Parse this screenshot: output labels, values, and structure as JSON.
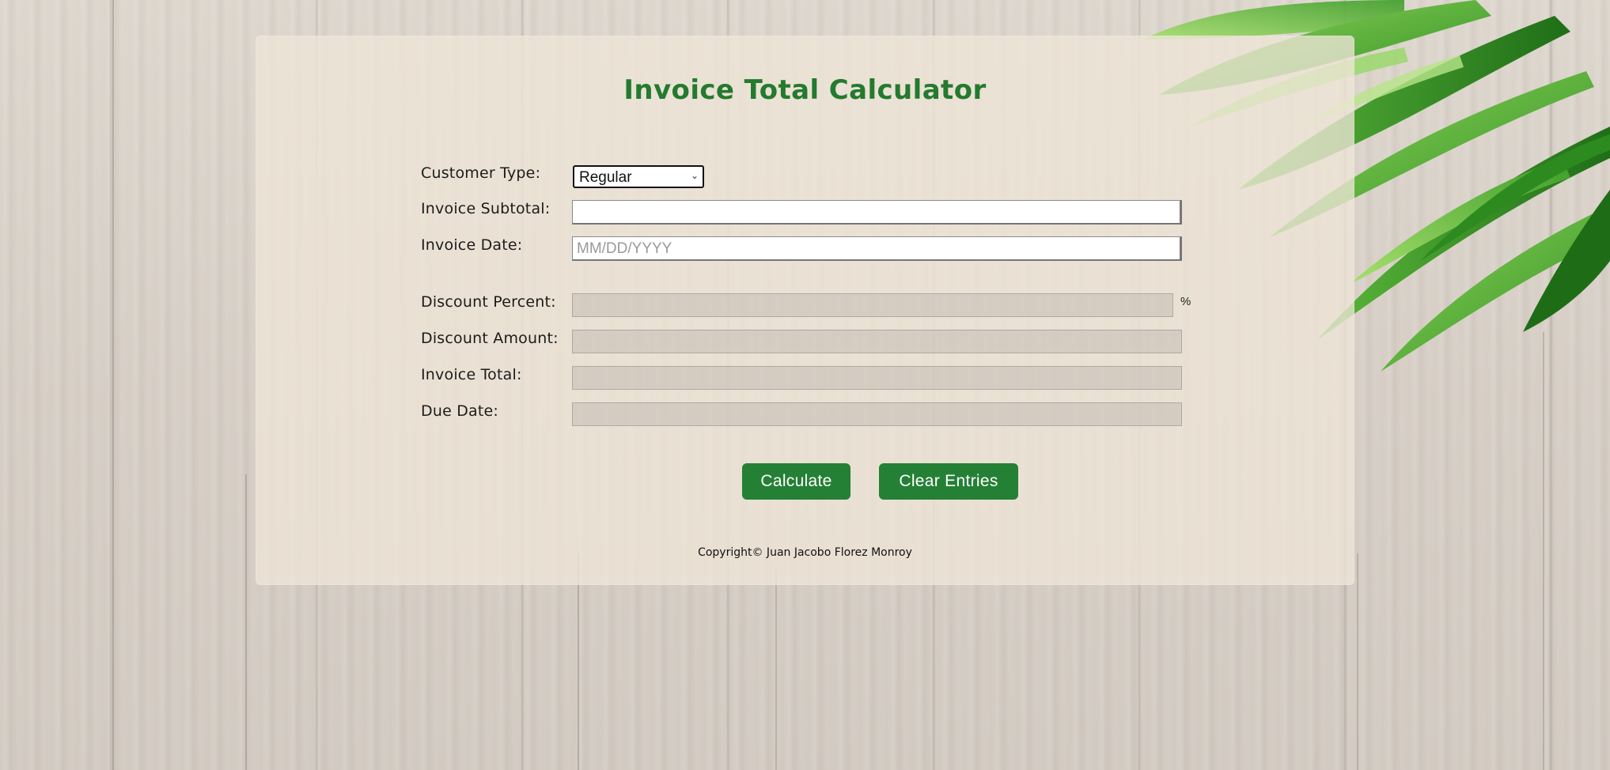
{
  "page": {
    "title": "Invoice Total Calculator",
    "copyright": "Copyright© Juan Jacobo Florez Monroy"
  },
  "form": {
    "customer_type": {
      "label": "Customer Type:",
      "selected": "Regular"
    },
    "invoice_subtotal": {
      "label": "Invoice Subtotal:",
      "value": ""
    },
    "invoice_date": {
      "label": "Invoice Date:",
      "placeholder": "MM/DD/YYYY",
      "value": ""
    },
    "discount_percent": {
      "label": "Discount Percent:",
      "value": "",
      "unit": "%"
    },
    "discount_amount": {
      "label": "Discount Amount:",
      "value": ""
    },
    "invoice_total": {
      "label": "Invoice Total:",
      "value": ""
    },
    "due_date": {
      "label": "Due Date:",
      "value": ""
    }
  },
  "buttons": {
    "calculate": "Calculate",
    "clear": "Clear Entries"
  },
  "colors": {
    "accent": "#247a2e",
    "button": "#248035"
  },
  "icons": {
    "select_chevron": "chevron-down-icon",
    "background_image": "leaves-decoration"
  }
}
